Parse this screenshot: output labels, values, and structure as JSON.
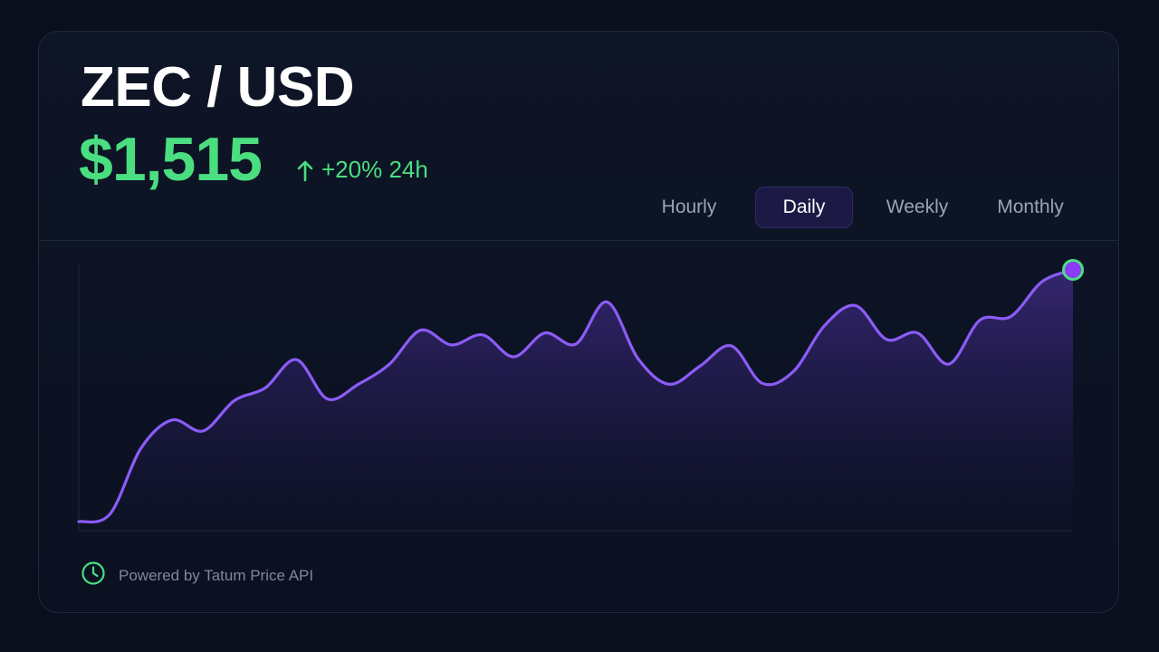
{
  "header": {
    "pair": "ZEC / USD",
    "price": "$1,515",
    "change": "+20% 24h"
  },
  "tabs": [
    {
      "label": "Hourly",
      "active": false
    },
    {
      "label": "Daily",
      "active": true
    },
    {
      "label": "Weekly",
      "active": false
    },
    {
      "label": "Monthly",
      "active": false
    }
  ],
  "footer": {
    "text": "Powered by Tatum Price API"
  },
  "colors": {
    "accent_green": "#4ade80",
    "line_purple": "#8b5cf6",
    "active_tab_bg": "#1c1a45"
  },
  "icons": {
    "change": "arrow-up-icon",
    "footer": "clock-icon"
  },
  "chart_data": {
    "type": "area",
    "title": "",
    "xlabel": "",
    "ylabel": "",
    "x": [
      0,
      1,
      2,
      3,
      4,
      5,
      6,
      7,
      8,
      9,
      10,
      11,
      12,
      13,
      14,
      15,
      16,
      17,
      18,
      19,
      20,
      21,
      22,
      23,
      24,
      25,
      26,
      27,
      28,
      29,
      30,
      31,
      32
    ],
    "values": [
      4,
      12,
      84,
      115,
      103,
      136,
      150,
      181,
      138,
      154,
      176,
      213,
      197,
      208,
      184,
      210,
      198,
      244,
      182,
      154,
      174,
      196,
      155,
      168,
      218,
      240,
      203,
      210,
      176,
      224,
      228,
      266,
      279
    ],
    "ylim": [
      0,
      279
    ],
    "grid": false,
    "legend": "none"
  }
}
